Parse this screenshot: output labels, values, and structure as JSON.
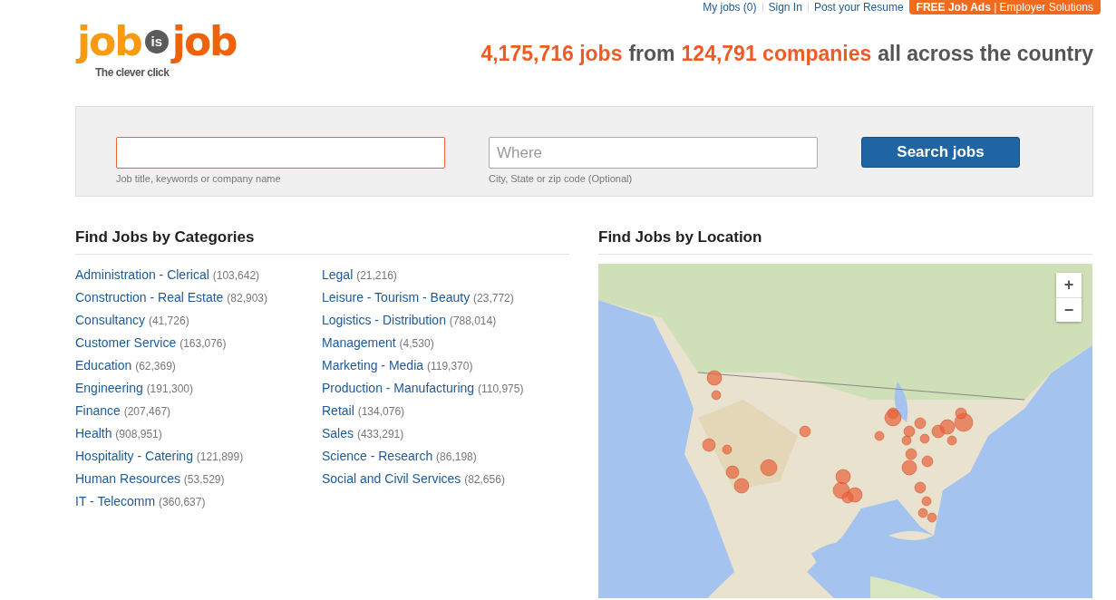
{
  "top_links": [
    {
      "label": "My jobs (0)"
    },
    {
      "label": "Sign In"
    },
    {
      "label": "Post your Resume"
    }
  ],
  "employer_button": "**FREE Job Ads** | Employer Solutions",
  "logo": {
    "words": [
      "job",
      "is",
      "job"
    ],
    "tagline": "The clever click"
  },
  "headline": [
    {
      "text": "4,175,716 jobs",
      "highlight": true
    },
    {
      "text": "from",
      "highlight": false
    },
    {
      "text": "124,791 companies",
      "highlight": true
    },
    {
      "text": "all across the country",
      "highlight": false
    }
  ],
  "search": {
    "what": {
      "hint": "Job title, keywords or company name",
      "focused": true
    },
    "where": {
      "placeholder": "Where",
      "hint": "City, State or zip code (Optional)",
      "focused": false
    },
    "button": "Search jobs"
  },
  "categories": {
    "title": "Find Jobs by Categories",
    "columns": [
      [
        {
          "name": "Administration - Clerical",
          "count": "(103,642)"
        },
        {
          "name": "Construction - Real Estate",
          "count": "(82,903)"
        },
        {
          "name": "Consultancy",
          "count": "(41,726)"
        },
        {
          "name": "Customer Service",
          "count": "(163,076)"
        },
        {
          "name": "Education",
          "count": "(62,369)"
        },
        {
          "name": "Engineering",
          "count": "(191,300)"
        },
        {
          "name": "Finance",
          "count": "(207,467)"
        },
        {
          "name": "Health",
          "count": "(908,951)"
        },
        {
          "name": "Hospitality - Catering",
          "count": "(121,899)"
        },
        {
          "name": "Human Resources",
          "count": "(53,529)"
        },
        {
          "name": "IT - Telecomm",
          "count": "(360,637)"
        }
      ],
      [
        {
          "name": "Legal",
          "count": "(21,216)"
        },
        {
          "name": "Leisure - Tourism - Beauty",
          "count": "(23,772)"
        },
        {
          "name": "Logistics - Distribution",
          "count": "(788,014)"
        },
        {
          "name": "Management",
          "count": "(4,530)"
        },
        {
          "name": "Marketing - Media",
          "count": "(119,370)"
        },
        {
          "name": "Production - Manufacturing",
          "count": "(110,975)"
        },
        {
          "name": "Retail",
          "count": "(134,076)"
        },
        {
          "name": "Sales",
          "count": "(433,291)"
        },
        {
          "name": "Science - Research",
          "count": "(86,198)"
        },
        {
          "name": "Social and Civil Services",
          "count": "(82,656)"
        }
      ]
    ]
  },
  "location": {
    "title": "Find Jobs by Location",
    "map": {
      "kind": "picture",
      "zoom_in": "+",
      "zoom_out": "−"
    }
  }
}
